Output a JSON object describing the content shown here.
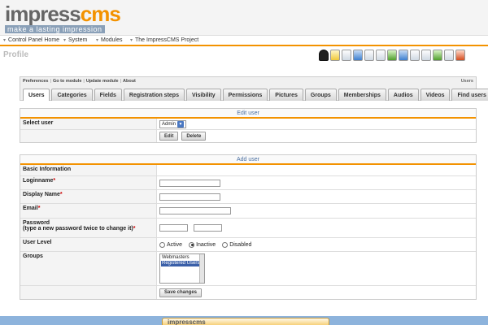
{
  "branding": {
    "logo_left": "impress",
    "logo_right": "cms",
    "tagline": "make a lasting impression",
    "accent_color": "#f39200"
  },
  "menu": [
    {
      "label": "Control Panel Home"
    },
    {
      "label": "System"
    },
    {
      "label": "Modules"
    },
    {
      "label": "The ImpressCMS Project"
    }
  ],
  "page": {
    "title": "Profile"
  },
  "toolbar_icons": [
    "user-icon",
    "notes-icon",
    "document-icon",
    "image-icon",
    "gamepad-icon",
    "bookmark-icon",
    "picture-icon",
    "book-icon",
    "user-outline-icon",
    "audio-icon",
    "film-icon",
    "search-icon",
    "settings-icon"
  ],
  "module_links": [
    "Preferences",
    "Go to module",
    "Update module",
    "About"
  ],
  "module_name": "Users",
  "tabs": [
    "Users",
    "Categories",
    "Fields",
    "Registration steps",
    "Visibility",
    "Permissions",
    "Pictures",
    "Groups",
    "Memberships",
    "Audios",
    "Videos",
    "Find users"
  ],
  "edit_user": {
    "heading": "Edit user",
    "select_label": "Select user",
    "selected_user": "Admin",
    "edit_button": "Edit",
    "delete_button": "Delete"
  },
  "add_user": {
    "heading": "Add user",
    "basic_info": "Basic Information",
    "loginname_label": "Loginname",
    "display_name_label": "Display Name",
    "email_label": "Email",
    "password_label": "Password",
    "password_hint": "(type a new password twice to change it)",
    "user_level_label": "User Level",
    "level_options": [
      "Active",
      "Inactive",
      "Disabled"
    ],
    "level_selected": "Inactive",
    "groups_label": "Groups",
    "groups_options": [
      "Webmasters",
      "Registered Users"
    ],
    "groups_selected": "Registered Users",
    "required_marker": "*",
    "save_button": "Save changes"
  },
  "footer": {
    "logo_text": "impresscms"
  }
}
